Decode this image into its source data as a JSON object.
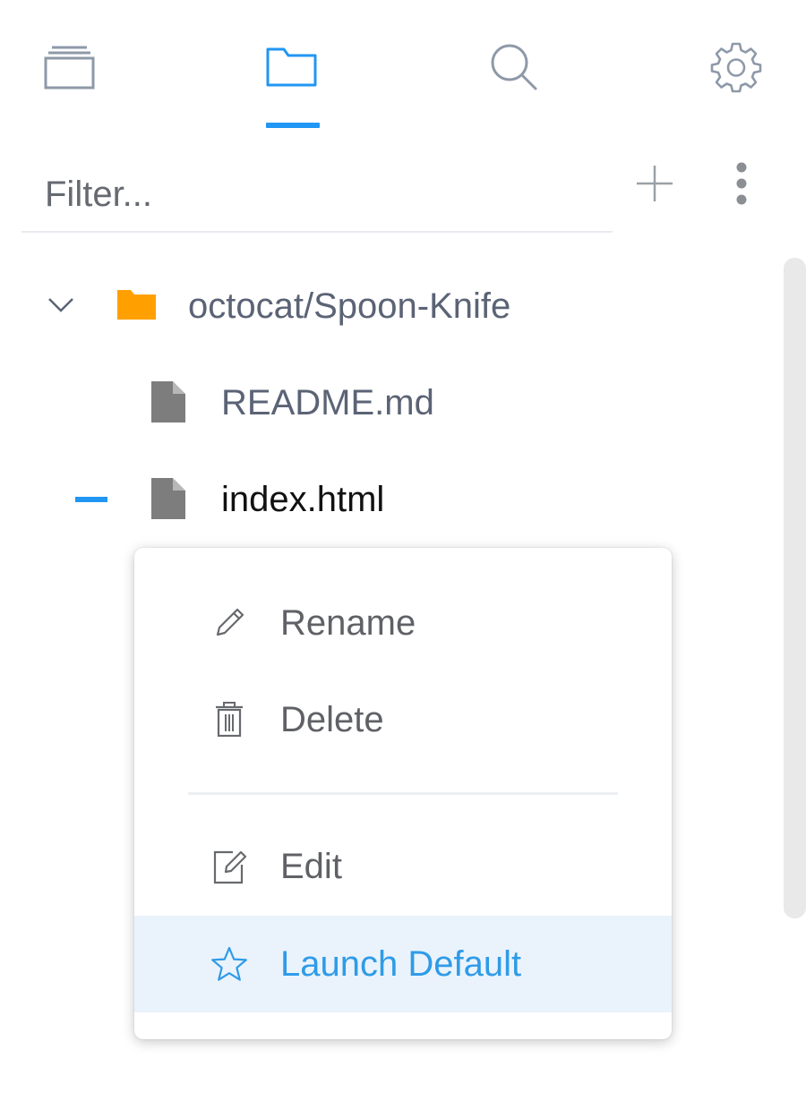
{
  "tabs": [
    {
      "id": "windows",
      "icon": "windows-stack-icon",
      "active": false
    },
    {
      "id": "files",
      "icon": "folder-icon",
      "active": true
    },
    {
      "id": "search",
      "icon": "search-icon",
      "active": false
    },
    {
      "id": "settings",
      "icon": "gear-icon",
      "active": false
    }
  ],
  "filter": {
    "placeholder": "Filter...",
    "value": ""
  },
  "toolbar": {
    "add_icon": "plus-icon",
    "more_icon": "more-vertical-icon"
  },
  "tree": {
    "root": {
      "label": "octocat/Spoon-Knife",
      "expanded": true,
      "icon": "folder-icon"
    },
    "files": [
      {
        "label": "README.md",
        "icon": "file-icon",
        "selected": false
      },
      {
        "label": "index.html",
        "icon": "file-icon",
        "selected": true
      }
    ]
  },
  "context_menu": {
    "items": [
      {
        "label": "Rename",
        "icon": "pencil-icon"
      },
      {
        "label": "Delete",
        "icon": "trash-icon"
      },
      {
        "label": "Edit",
        "icon": "edit-square-icon"
      },
      {
        "label": "Launch Default",
        "icon": "star-icon",
        "highlighted": true
      }
    ]
  },
  "colors": {
    "accent": "#2196f3",
    "folder": "#ffa000",
    "file_icon": "#7d7d7d",
    "text": "#5b6375",
    "menu_highlight_bg": "#eaf3fc"
  }
}
